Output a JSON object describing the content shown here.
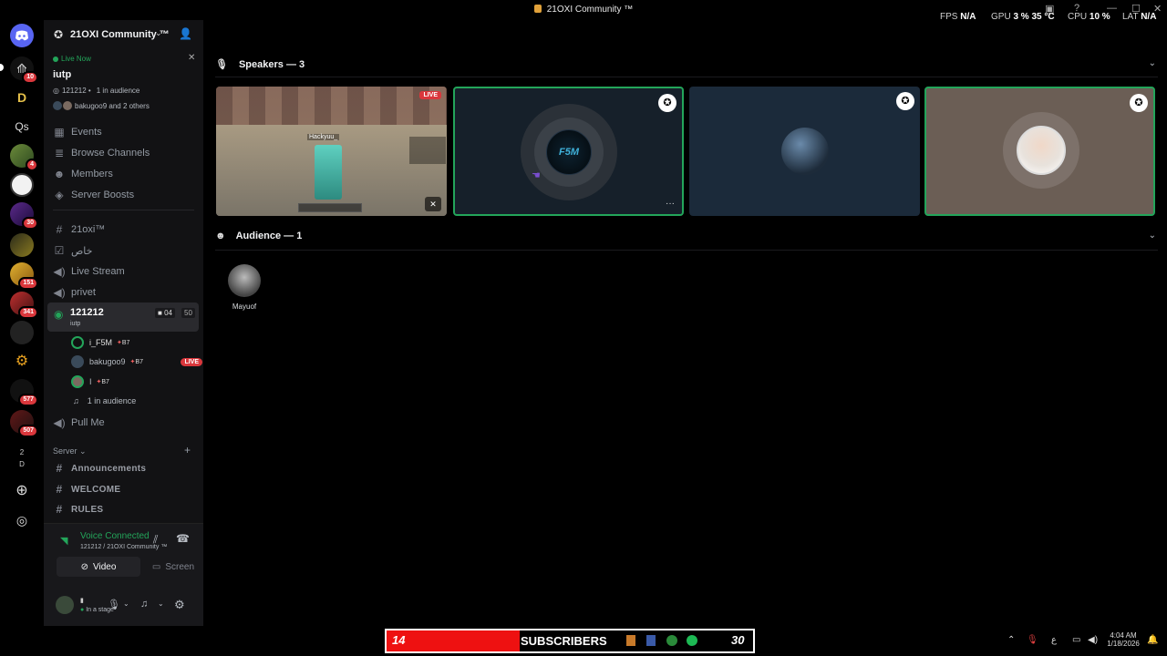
{
  "window": {
    "title": "21OXI Community ™",
    "perf": {
      "fps_label": "FPS",
      "fps": "N/A",
      "gpu_label": "GPU",
      "gpu": "3 %",
      "gpu_temp": "35 °C",
      "cpu_label": "CPU",
      "cpu": "10 %",
      "lat_label": "LAT",
      "lat": "N/A"
    }
  },
  "rail": {
    "badges": [
      "10",
      "4",
      "30",
      "151",
      "341",
      "577",
      "507"
    ],
    "qs_label": "Qs",
    "small_labels": [
      "2",
      "D"
    ]
  },
  "server": {
    "name": "21OXI Community ™",
    "live": {
      "status": "Live Now",
      "title": "iutp",
      "meta": "121212 •   1 in audience",
      "viewers": "bakugoo9 and 2 others"
    },
    "nav": [
      "Events",
      "Browse Channels",
      "Members",
      "Server Boosts"
    ],
    "channels": [
      {
        "name": "21oxi™",
        "type": "text"
      },
      {
        "name": "خاص",
        "type": "text"
      },
      {
        "name": "Live Stream",
        "type": "voice"
      },
      {
        "name": "privet",
        "type": "voice"
      }
    ],
    "active_stage": {
      "name": "121212",
      "topic": "iutp",
      "count_a": "04",
      "count_b": "50",
      "members": [
        {
          "name": "i_F5M",
          "tag": "B7",
          "live": false
        },
        {
          "name": "bakugoo9",
          "tag": "B7",
          "live": true,
          "live_label": "LIVE"
        },
        {
          "name": "I",
          "tag": "B7",
          "live": false
        }
      ],
      "audience_label": "1 in audience"
    },
    "pull_me": "Pull Me",
    "category": "Server",
    "text_channels": [
      "Announcements",
      "WELCOME",
      "RULES"
    ]
  },
  "voice_panel": {
    "status": "Voice Connected",
    "location": "121212 / 21OXI Community ™",
    "video_label": "Video",
    "screen_label": "Screen",
    "user_status": "In a stage"
  },
  "stage": {
    "speakers_header": "Speakers — 3",
    "audience_header": "Audience — 1",
    "live_label": "LIVE",
    "stream_name": "Hackyuu_",
    "f5m_logo": "F5M",
    "audience": [
      {
        "name": "Mayuof"
      }
    ]
  },
  "taskbar": {
    "left_count": "14",
    "subscribers": "SUBSCRIBERS",
    "right_count": "30",
    "time": "4:04 AM",
    "date": "1/18/2026",
    "lang": "ع"
  },
  "colors": {
    "green": "#23a55a",
    "red": "#da373c",
    "tile_dark": "#16202a",
    "tile_blue": "#1b2a3a",
    "tile_beige": "#6b5e55"
  }
}
